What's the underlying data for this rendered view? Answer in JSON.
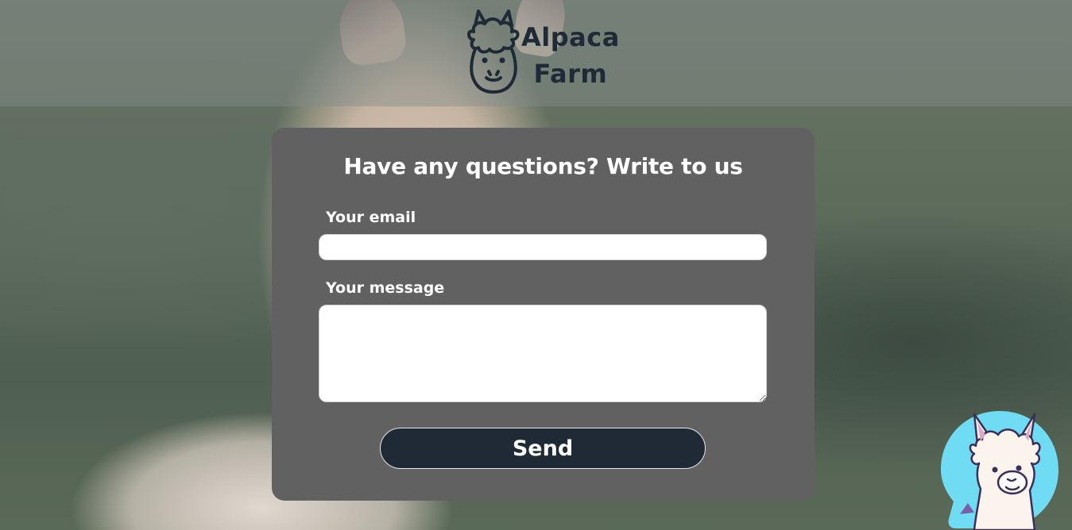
{
  "brand": {
    "logo_line1": "Alpaca",
    "logo_line2": "Farm",
    "logo_icon": "alpaca-head-icon"
  },
  "form": {
    "title": "Have any questions? Write to us",
    "email_label": "Your email",
    "email_value": "",
    "message_label": "Your message",
    "message_value": "",
    "send_label": "Send"
  },
  "chat_widget": {
    "icon": "alpaca-chat-icon"
  },
  "colors": {
    "card_background": "#616161",
    "button_background": "#1f2a36",
    "logo_color": "#1e2a36",
    "chat_widget_bg": "#6fdcf3"
  }
}
